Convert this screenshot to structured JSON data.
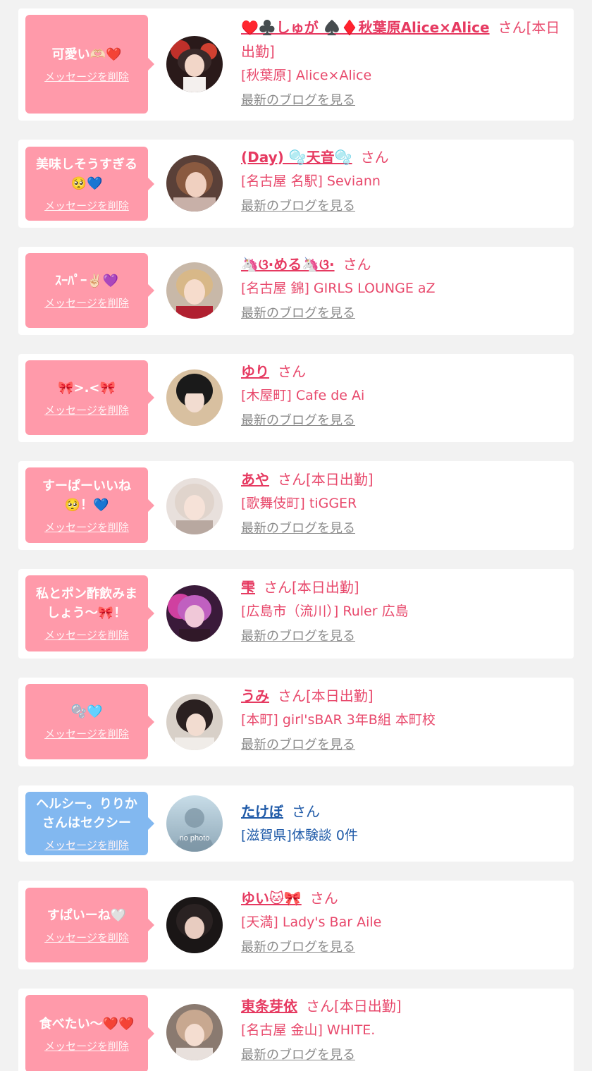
{
  "labels": {
    "delete": "メッセージを削除",
    "latest_blog": "最新のブログを見る",
    "san": "さん",
    "no_photo": "no photo"
  },
  "entries": [
    {
      "message": "可愛い🫶🏻❤️",
      "name": "♥️♣️しゅが ♠️♦️秋葉原Alice×Alice",
      "status": "[本日出勤]",
      "shop": "[秋葉原] Alice×Alice",
      "type": "cast"
    },
    {
      "message": "美味しそうすぎる🥺💙",
      "name": "(Day) 🫧天音🫧",
      "status": "",
      "shop": "[名古屋 名駅] Seviann",
      "type": "cast"
    },
    {
      "message": "ｽｰﾊﾟｰ✌🏻💜",
      "name": "🦄ଓ·める🦄ଓ·",
      "status": "",
      "shop": "[名古屋 錦] GIRLS LOUNGE aZ",
      "type": "cast"
    },
    {
      "message": "🎀>.<🎀",
      "name": "ゆり",
      "status": "",
      "shop": "[木屋町] Cafe de Ai",
      "type": "cast"
    },
    {
      "message": "すーぱーいいね🥺！💙",
      "name": "あや",
      "status": "[本日出勤]",
      "shop": "[歌舞伎町] tiGGER",
      "type": "cast"
    },
    {
      "message": "私とポン酢飲みましょう〜🎀！",
      "name": "雫",
      "status": "[本日出勤]",
      "shop": "[広島市（流川）] Ruler 広島",
      "type": "cast"
    },
    {
      "message": "🫧🩵",
      "name": "うみ",
      "status": "[本日出勤]",
      "shop": "[本町] girl'sBAR 3年B組 本町校",
      "type": "cast"
    },
    {
      "message": "ヘルシー。りりかさんはセクシー",
      "name": "たけぼ",
      "status": "",
      "shop": "[滋賀県]体験談 0件",
      "type": "user"
    },
    {
      "message": "すぱいーね🤍",
      "name": "ゆい🐱🎀",
      "status": "",
      "shop": "[天満] Lady's Bar Aile",
      "type": "cast"
    },
    {
      "message": "食べたい〜❤️❤️",
      "name": "東条芽依",
      "status": "[本日出勤]",
      "shop": "[名古屋 金山] WHITE.",
      "type": "cast"
    }
  ],
  "colors": {
    "background": "#f2f2f2",
    "card": "#ffffff",
    "bubble_cast": "#ff9aaa",
    "bubble_user": "#82b8f0",
    "name_cast": "#e63a61",
    "name_user": "#1f5aa8",
    "link_gray": "#8a8a8a"
  }
}
